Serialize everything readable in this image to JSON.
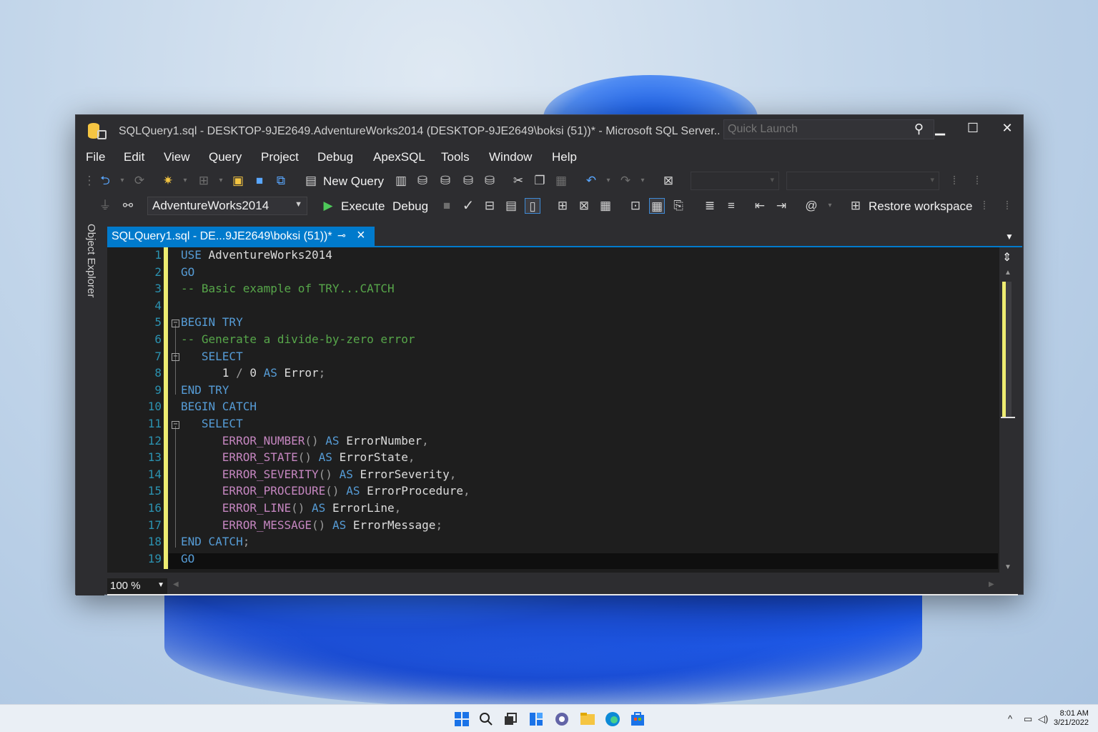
{
  "window": {
    "title": "SQLQuery1.sql - DESKTOP-9JE2649.AdventureWorks2014 (DESKTOP-9JE2649\\boksi (51))* - Microsoft SQL Server...",
    "quick_launch_placeholder": "Quick Launch",
    "controls": {
      "minimize": "▁",
      "maximize": "☐",
      "close": "✕"
    }
  },
  "menu": [
    "File",
    "Edit",
    "View",
    "Query",
    "Project",
    "Debug",
    "ApexSQL",
    "Tools",
    "Window",
    "Help"
  ],
  "toolbar1": {
    "new_query_label": "New Query"
  },
  "toolbar2": {
    "database": "AdventureWorks2014",
    "execute_label": "Execute",
    "debug_label": "Debug",
    "restore_label": "Restore workspace"
  },
  "sidebar": {
    "object_explorer_label": "Object Explorer"
  },
  "document_tab": {
    "label": "SQLQuery1.sql - DE...9JE2649\\boksi (51))*"
  },
  "editor": {
    "line_numbers": [
      "1",
      "2",
      "3",
      "4",
      "5",
      "6",
      "7",
      "8",
      "9",
      "10",
      "11",
      "12",
      "13",
      "14",
      "15",
      "16",
      "17",
      "18",
      "19"
    ],
    "lines": [
      [
        {
          "t": "USE ",
          "c": "kw"
        },
        {
          "t": "AdventureWorks2014",
          "c": "id"
        }
      ],
      [
        {
          "t": "GO",
          "c": "kw"
        }
      ],
      [
        {
          "t": "-- Basic example of TRY...CATCH",
          "c": "cm"
        }
      ],
      [],
      [
        {
          "t": "BEGIN TRY",
          "c": "kw"
        }
      ],
      [
        {
          "t": "-- Generate a divide-by-zero error",
          "c": "cm"
        }
      ],
      [
        {
          "t": "   SELECT",
          "c": "kw"
        }
      ],
      [
        {
          "t": "      1 ",
          "c": "id"
        },
        {
          "t": "/ ",
          "c": "op"
        },
        {
          "t": "0 ",
          "c": "id"
        },
        {
          "t": "AS ",
          "c": "kw"
        },
        {
          "t": "Error",
          "c": "id"
        },
        {
          "t": ";",
          "c": "op"
        }
      ],
      [
        {
          "t": "END TRY",
          "c": "kw"
        }
      ],
      [
        {
          "t": "BEGIN CATCH",
          "c": "kw"
        }
      ],
      [
        {
          "t": "   SELECT",
          "c": "kw"
        }
      ],
      [
        {
          "t": "      ",
          "c": "id"
        },
        {
          "t": "ERROR_NUMBER",
          "c": "fn"
        },
        {
          "t": "() ",
          "c": "op"
        },
        {
          "t": "AS ",
          "c": "kw"
        },
        {
          "t": "ErrorNumber",
          "c": "id"
        },
        {
          "t": ",",
          "c": "op"
        }
      ],
      [
        {
          "t": "      ",
          "c": "id"
        },
        {
          "t": "ERROR_STATE",
          "c": "fn"
        },
        {
          "t": "() ",
          "c": "op"
        },
        {
          "t": "AS ",
          "c": "kw"
        },
        {
          "t": "ErrorState",
          "c": "id"
        },
        {
          "t": ",",
          "c": "op"
        }
      ],
      [
        {
          "t": "      ",
          "c": "id"
        },
        {
          "t": "ERROR_SEVERITY",
          "c": "fn"
        },
        {
          "t": "() ",
          "c": "op"
        },
        {
          "t": "AS ",
          "c": "kw"
        },
        {
          "t": "ErrorSeverity",
          "c": "id"
        },
        {
          "t": ",",
          "c": "op"
        }
      ],
      [
        {
          "t": "      ",
          "c": "id"
        },
        {
          "t": "ERROR_PROCEDURE",
          "c": "fn"
        },
        {
          "t": "() ",
          "c": "op"
        },
        {
          "t": "AS ",
          "c": "kw"
        },
        {
          "t": "ErrorProcedure",
          "c": "id"
        },
        {
          "t": ",",
          "c": "op"
        }
      ],
      [
        {
          "t": "      ",
          "c": "id"
        },
        {
          "t": "ERROR_LINE",
          "c": "fn"
        },
        {
          "t": "() ",
          "c": "op"
        },
        {
          "t": "AS ",
          "c": "kw"
        },
        {
          "t": "ErrorLine",
          "c": "id"
        },
        {
          "t": ",",
          "c": "op"
        }
      ],
      [
        {
          "t": "      ",
          "c": "id"
        },
        {
          "t": "ERROR_MESSAGE",
          "c": "fn"
        },
        {
          "t": "() ",
          "c": "op"
        },
        {
          "t": "AS ",
          "c": "kw"
        },
        {
          "t": "ErrorMessage",
          "c": "id"
        },
        {
          "t": ";",
          "c": "op"
        }
      ],
      [
        {
          "t": "END CATCH",
          "c": "kw"
        },
        {
          "t": ";",
          "c": "op"
        }
      ],
      [
        {
          "t": "GO",
          "c": "kw"
        }
      ]
    ]
  },
  "zoom": "100 %",
  "taskbar": {
    "clock_time": "8:01 AM",
    "clock_date": "3/21/2022"
  },
  "colors": {
    "keyword": "#569cd6",
    "comment": "#57a64a",
    "function": "#c586c0",
    "line_number": "#2b91af",
    "accent": "#007acc",
    "change_bar": "#eeec71"
  }
}
